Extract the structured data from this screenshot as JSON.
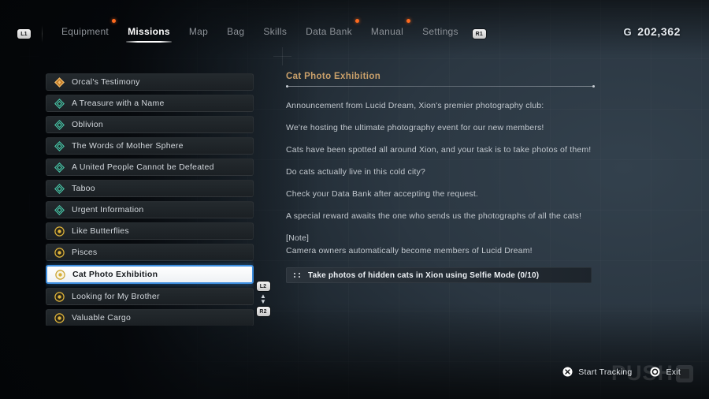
{
  "nav": {
    "left_bumper": "L1",
    "right_bumper": "R1",
    "tabs": [
      {
        "label": "Equipment",
        "active": false,
        "dot": true
      },
      {
        "label": "Missions",
        "active": true,
        "dot": false
      },
      {
        "label": "Map",
        "active": false,
        "dot": false
      },
      {
        "label": "Bag",
        "active": false,
        "dot": false
      },
      {
        "label": "Skills",
        "active": false,
        "dot": false
      },
      {
        "label": "Data Bank",
        "active": false,
        "dot": true
      },
      {
        "label": "Manual",
        "active": false,
        "dot": true
      },
      {
        "label": "Settings",
        "active": false,
        "dot": false
      }
    ]
  },
  "currency": {
    "symbol": "G",
    "amount": "202,362"
  },
  "missions": {
    "items": [
      {
        "label": "Orcal's Testimony",
        "icon": "orange-diamond-arrow-icon",
        "selected": false
      },
      {
        "label": "A Treasure with a Name",
        "icon": "teal-diamond-icon",
        "selected": false
      },
      {
        "label": "Oblivion",
        "icon": "teal-diamond-icon",
        "selected": false
      },
      {
        "label": "The Words of Mother Sphere",
        "icon": "teal-diamond-icon",
        "selected": false
      },
      {
        "label": "A United People Cannot be Defeated",
        "icon": "teal-diamond-icon",
        "selected": false
      },
      {
        "label": "Taboo",
        "icon": "teal-diamond-icon",
        "selected": false
      },
      {
        "label": "Urgent Information",
        "icon": "teal-diamond-icon",
        "selected": false
      },
      {
        "label": "Like Butterflies",
        "icon": "gold-circle-icon",
        "selected": false
      },
      {
        "label": "Pisces",
        "icon": "gold-circle-icon",
        "selected": false
      },
      {
        "label": "Cat Photo Exhibition",
        "icon": "gold-circle-icon",
        "selected": true
      },
      {
        "label": "Looking for My Brother",
        "icon": "gold-circle-icon",
        "selected": false
      },
      {
        "label": "Valuable Cargo",
        "icon": "gold-circle-icon",
        "selected": false
      }
    ],
    "scroll_hint": {
      "up_button": "L2",
      "down_button": "R2",
      "arrows": "▲▼"
    }
  },
  "detail": {
    "title": "Cat Photo Exhibition",
    "paragraphs": [
      "Announcement from Lucid Dream, Xion's premier photography club:",
      "We're hosting the ultimate photography event for our new members!",
      "Cats have been spotted all around Xion, and your task is to take photos of them!",
      "Do cats actually live in this cold city?",
      "Check your Data Bank after accepting the request.",
      "A special reward awaits the one who sends us the photographs of all the cats!"
    ],
    "note_header": "[Note]",
    "note_body": "Camera owners automatically become members of Lucid Dream!",
    "objective": "Take photos of hidden cats in Xion using Selfie Mode (0/10)"
  },
  "footer": {
    "start_tracking_label": "Start Tracking",
    "start_tracking_glyph": "cross-button-icon",
    "exit_label": "Exit",
    "exit_glyph": "circle-button-icon"
  },
  "watermark": {
    "text": "PUSH"
  },
  "colors": {
    "accent_gold": "#caa06a",
    "select_blue": "#3d8ee0",
    "notif_orange": "#ff6a1e",
    "icon_teal": "#49c4a8",
    "icon_gold": "#e0b53c"
  }
}
